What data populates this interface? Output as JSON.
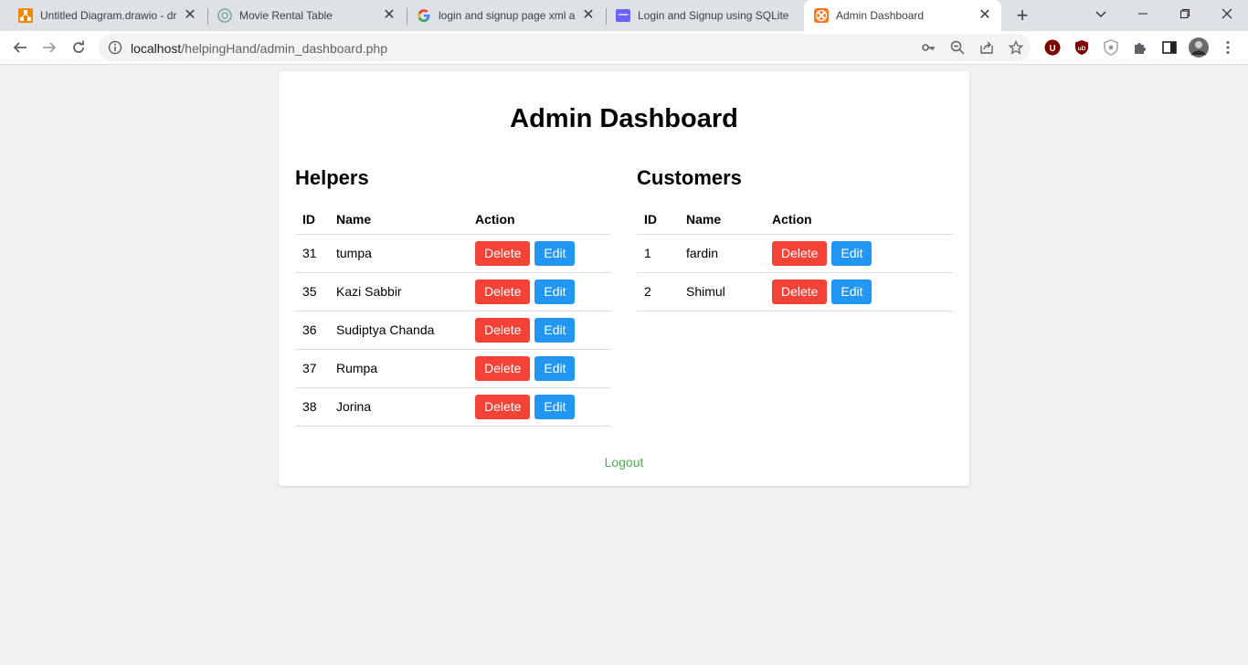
{
  "browser": {
    "tabs": [
      {
        "title": "Untitled Diagram.drawio - dra",
        "favicon": "drawio-icon",
        "color": "#f08705"
      },
      {
        "title": "Movie Rental Table",
        "favicon": "chatgpt-icon",
        "color": "#74aa9c"
      },
      {
        "title": "login and signup page xml and",
        "favicon": "google-icon",
        "color": "#4285f4"
      },
      {
        "title": "Login and Signup using SQLite",
        "favicon": "site-icon",
        "color": "#6c63ff"
      },
      {
        "title": "Admin Dashboard",
        "favicon": "xampp-icon",
        "color": "#fb7a24"
      }
    ],
    "url_host": "localhost",
    "url_path": "/helpingHand/admin_dashboard.php"
  },
  "page": {
    "title": "Admin Dashboard",
    "helpers": {
      "heading": "Helpers",
      "columns": [
        "ID",
        "Name",
        "Action"
      ],
      "rows": [
        {
          "id": "31",
          "name": "tumpa"
        },
        {
          "id": "35",
          "name": "Kazi Sabbir"
        },
        {
          "id": "36",
          "name": "Sudiptya Chanda"
        },
        {
          "id": "37",
          "name": "Rumpa"
        },
        {
          "id": "38",
          "name": "Jorina"
        }
      ]
    },
    "customers": {
      "heading": "Customers",
      "columns": [
        "ID",
        "Name",
        "Action"
      ],
      "rows": [
        {
          "id": "1",
          "name": "fardin"
        },
        {
          "id": "2",
          "name": "Shimul"
        }
      ]
    },
    "delete_label": "Delete",
    "edit_label": "Edit",
    "logout_label": "Logout"
  },
  "colors": {
    "delete": "#f44336",
    "edit": "#2196f3",
    "logout": "#4caf50",
    "background": "#f1f1f1"
  }
}
